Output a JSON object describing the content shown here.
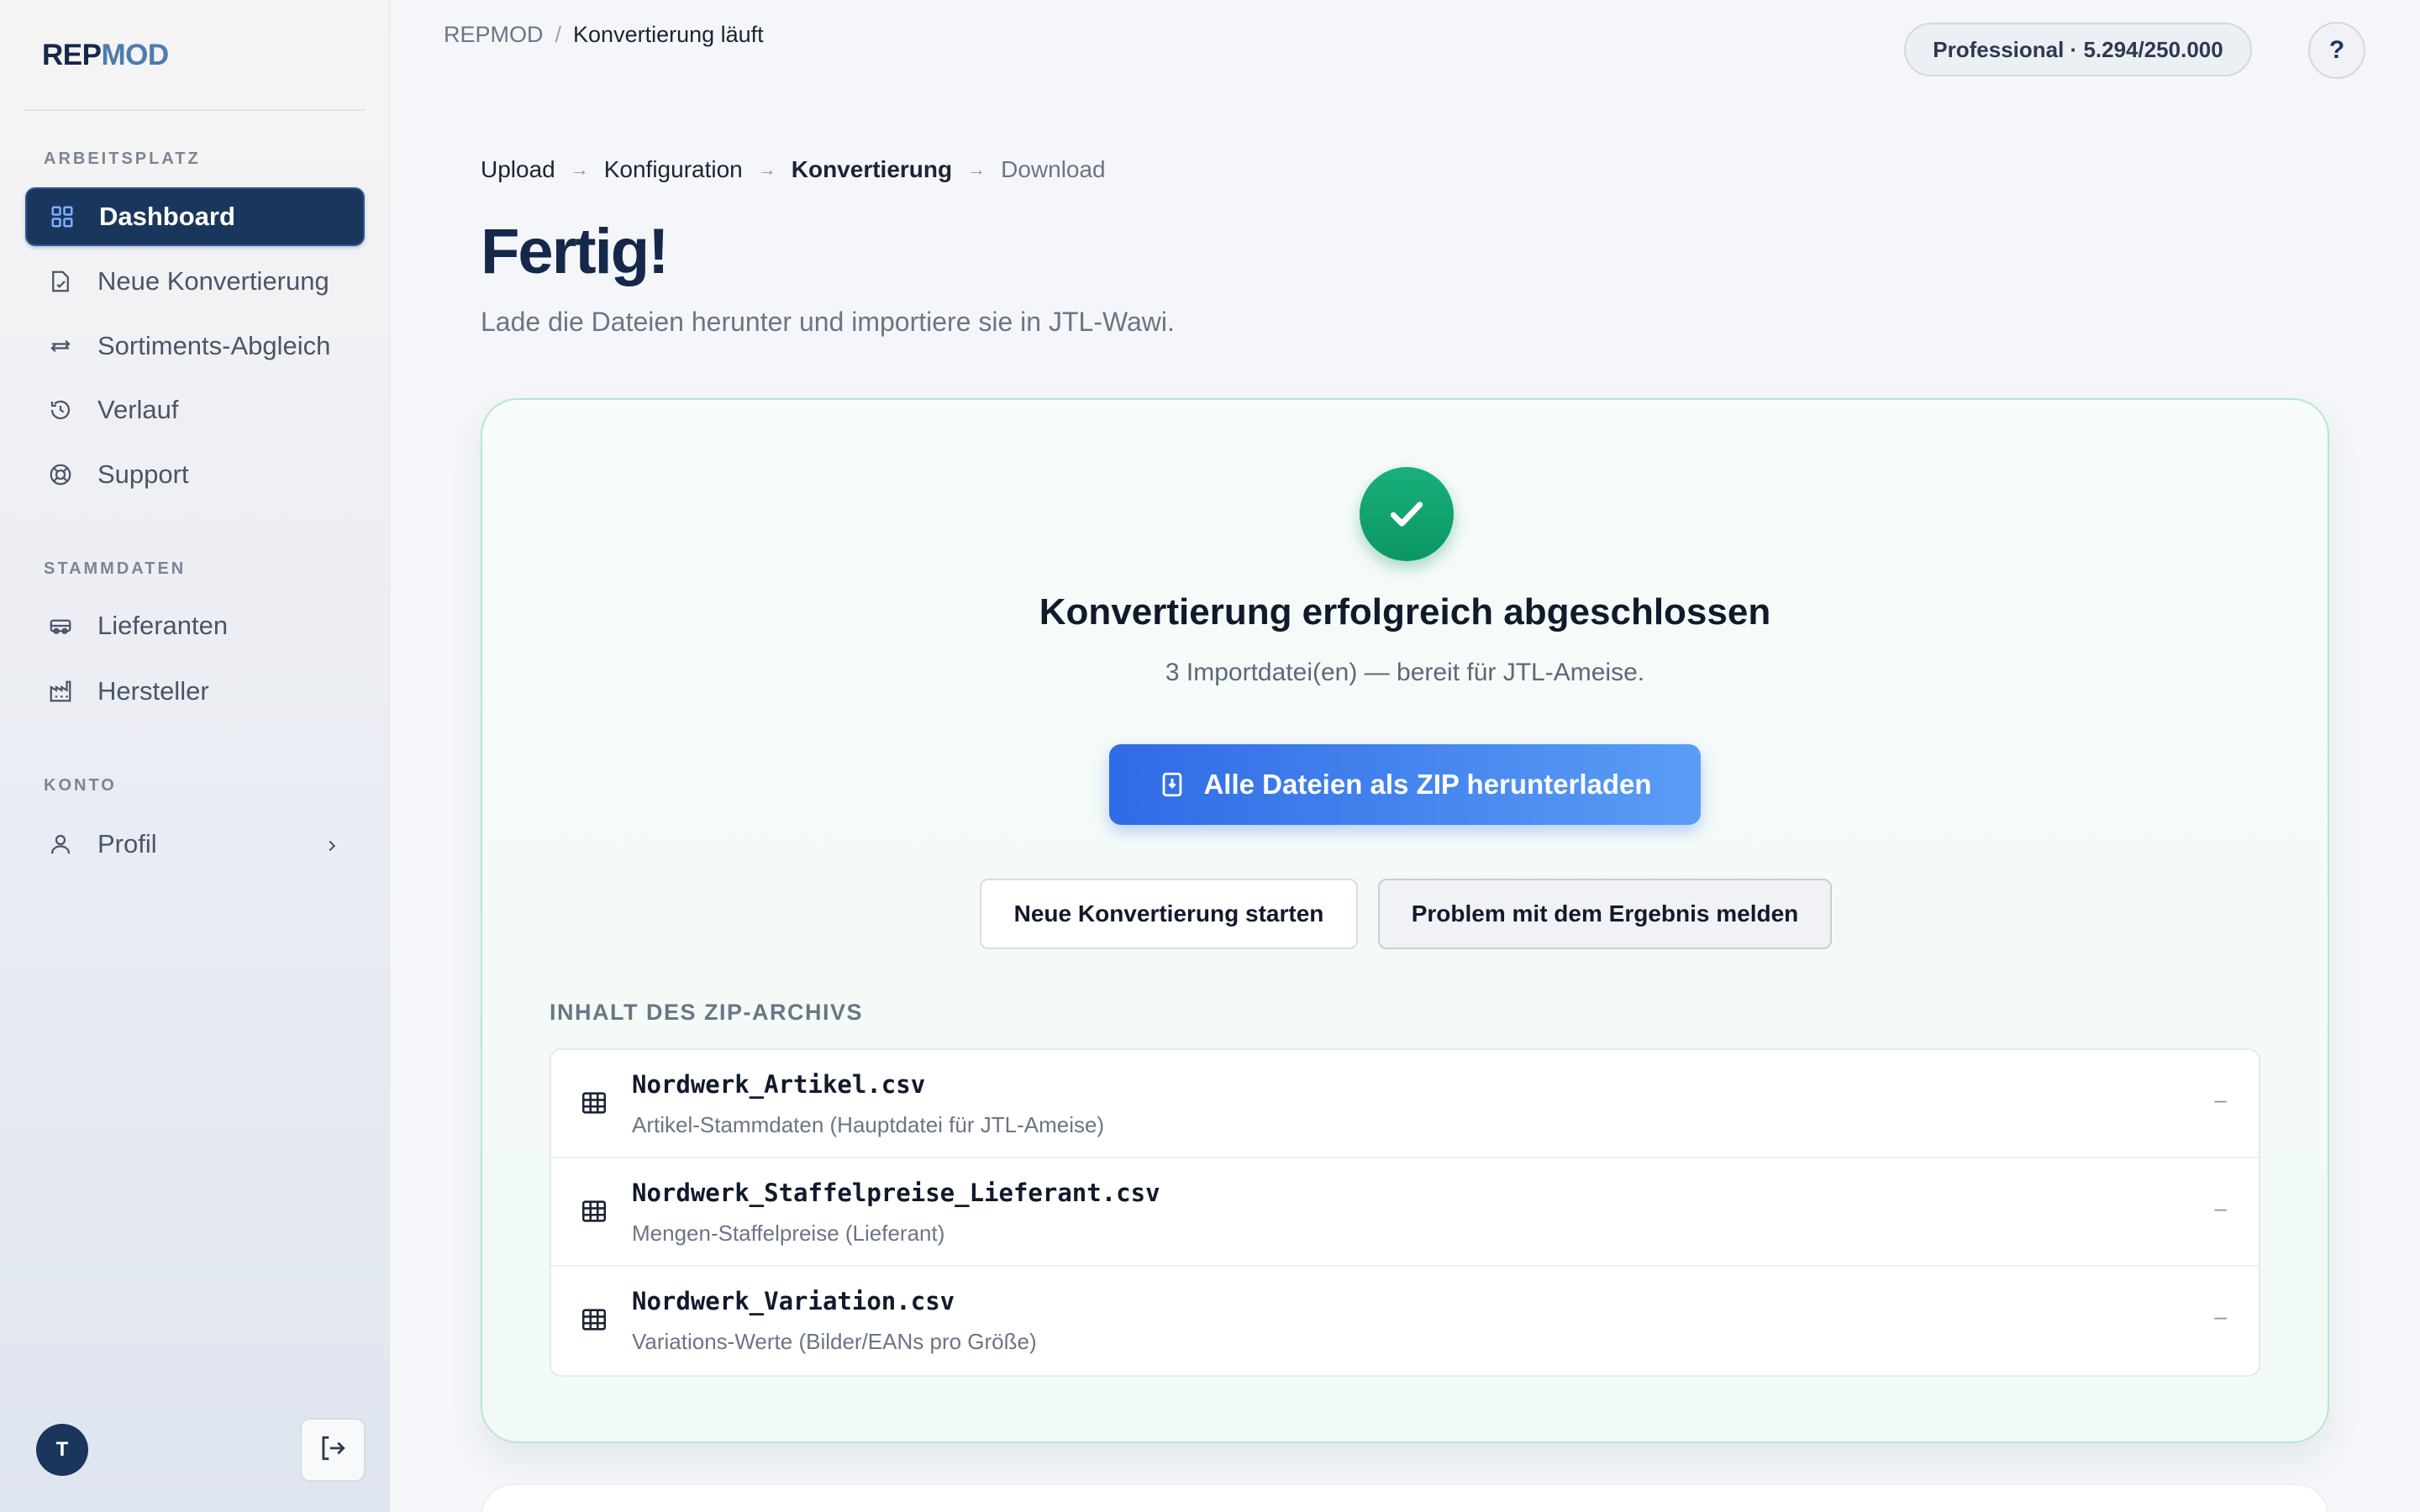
{
  "brand": {
    "part1": "REP",
    "part2": "MOD"
  },
  "sidebar": {
    "sections": [
      {
        "label": "ARBEITSPLATZ"
      },
      {
        "label": "STAMMDATEN"
      },
      {
        "label": "KONTO"
      }
    ],
    "items": [
      {
        "label": "Dashboard",
        "icon": "grid-icon"
      },
      {
        "label": "Neue Konvertierung",
        "icon": "file-edit-icon"
      },
      {
        "label": "Sortiments-Abgleich",
        "icon": "arrows-left-right-icon"
      },
      {
        "label": "Verlauf",
        "icon": "history-icon"
      },
      {
        "label": "Support",
        "icon": "lifebuoy-icon"
      },
      {
        "label": "Lieferanten",
        "icon": "truck-icon"
      },
      {
        "label": "Hersteller",
        "icon": "factory-icon"
      },
      {
        "label": "Profil",
        "icon": "user-icon"
      }
    ],
    "avatar_initial": "T"
  },
  "topbar": {
    "breadcrumb_root": "REPMOD",
    "breadcrumb_sep": "/",
    "breadcrumb_current": "Konvertierung läuft",
    "plan": "Professional · 5.294/250.000",
    "help": "?"
  },
  "steps": [
    "Upload",
    "Konfiguration",
    "Konvertierung",
    "Download"
  ],
  "page": {
    "title": "Fertig!",
    "subtitle": "Lade die Dateien herunter und importiere sie in JTL-Wawi."
  },
  "result": {
    "title": "Konvertierung erfolgreich abgeschlossen",
    "subtitle": "3 Importdatei(en) — bereit für JTL-Ameise.",
    "zip_button": "Alle Dateien als ZIP herunterladen",
    "new_button": "Neue Konvertierung starten",
    "report_button": "Problem mit dem Ergebnis melden",
    "zip_contents_label": "INHALT DES ZIP-ARCHIVS",
    "files": [
      {
        "name": "Nordwerk_Artikel.csv",
        "desc": "Artikel-Stammdaten (Hauptdatei für JTL-Ameise)",
        "size": "–"
      },
      {
        "name": "Nordwerk_Staffelpreise_Lieferant.csv",
        "desc": "Mengen-Staffelpreise (Lieferant)",
        "size": "–"
      },
      {
        "name": "Nordwerk_Variation.csv",
        "desc": "Variations-Werte (Bilder/EANs pro Größe)",
        "size": "–"
      }
    ]
  },
  "colors": {
    "primary_dark": "#1b365d",
    "accent_blue": "#2f6be6",
    "success_green": "#0c9764"
  }
}
